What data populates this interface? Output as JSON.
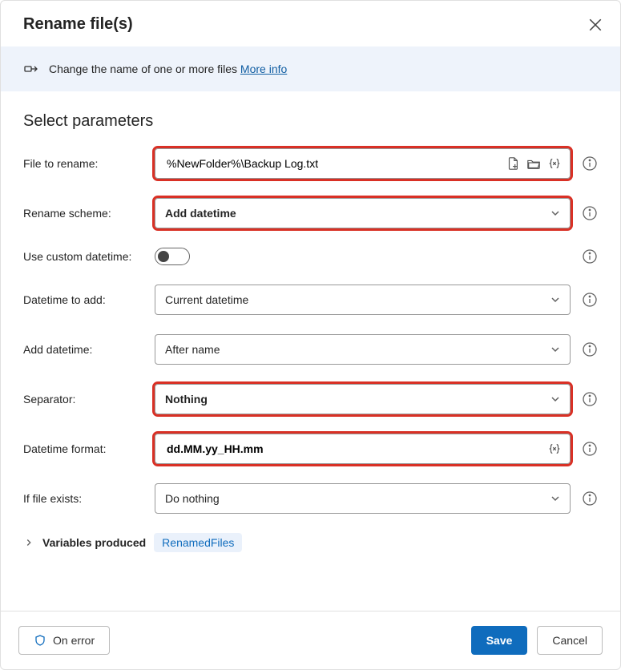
{
  "dialog": {
    "title": "Rename file(s)"
  },
  "infobar": {
    "text": "Change the name of one or more files ",
    "link": "More info"
  },
  "section_title": "Select parameters",
  "fields": {
    "file_to_rename": {
      "label": "File to rename:",
      "value": "%NewFolder%\\Backup Log.txt"
    },
    "rename_scheme": {
      "label": "Rename scheme:",
      "value": "Add datetime"
    },
    "use_custom": {
      "label": "Use custom datetime:"
    },
    "datetime_to_add": {
      "label": "Datetime to add:",
      "value": "Current datetime"
    },
    "add_datetime": {
      "label": "Add datetime:",
      "value": "After name"
    },
    "separator": {
      "label": "Separator:",
      "value": "Nothing"
    },
    "datetime_format": {
      "label": "Datetime format:",
      "value": "dd.MM.yy_HH.mm"
    },
    "if_file_exists": {
      "label": "If file exists:",
      "value": "Do nothing"
    }
  },
  "variables_produced": {
    "label": "Variables produced",
    "chip": "RenamedFiles"
  },
  "footer": {
    "on_error": "On error",
    "save": "Save",
    "cancel": "Cancel"
  }
}
